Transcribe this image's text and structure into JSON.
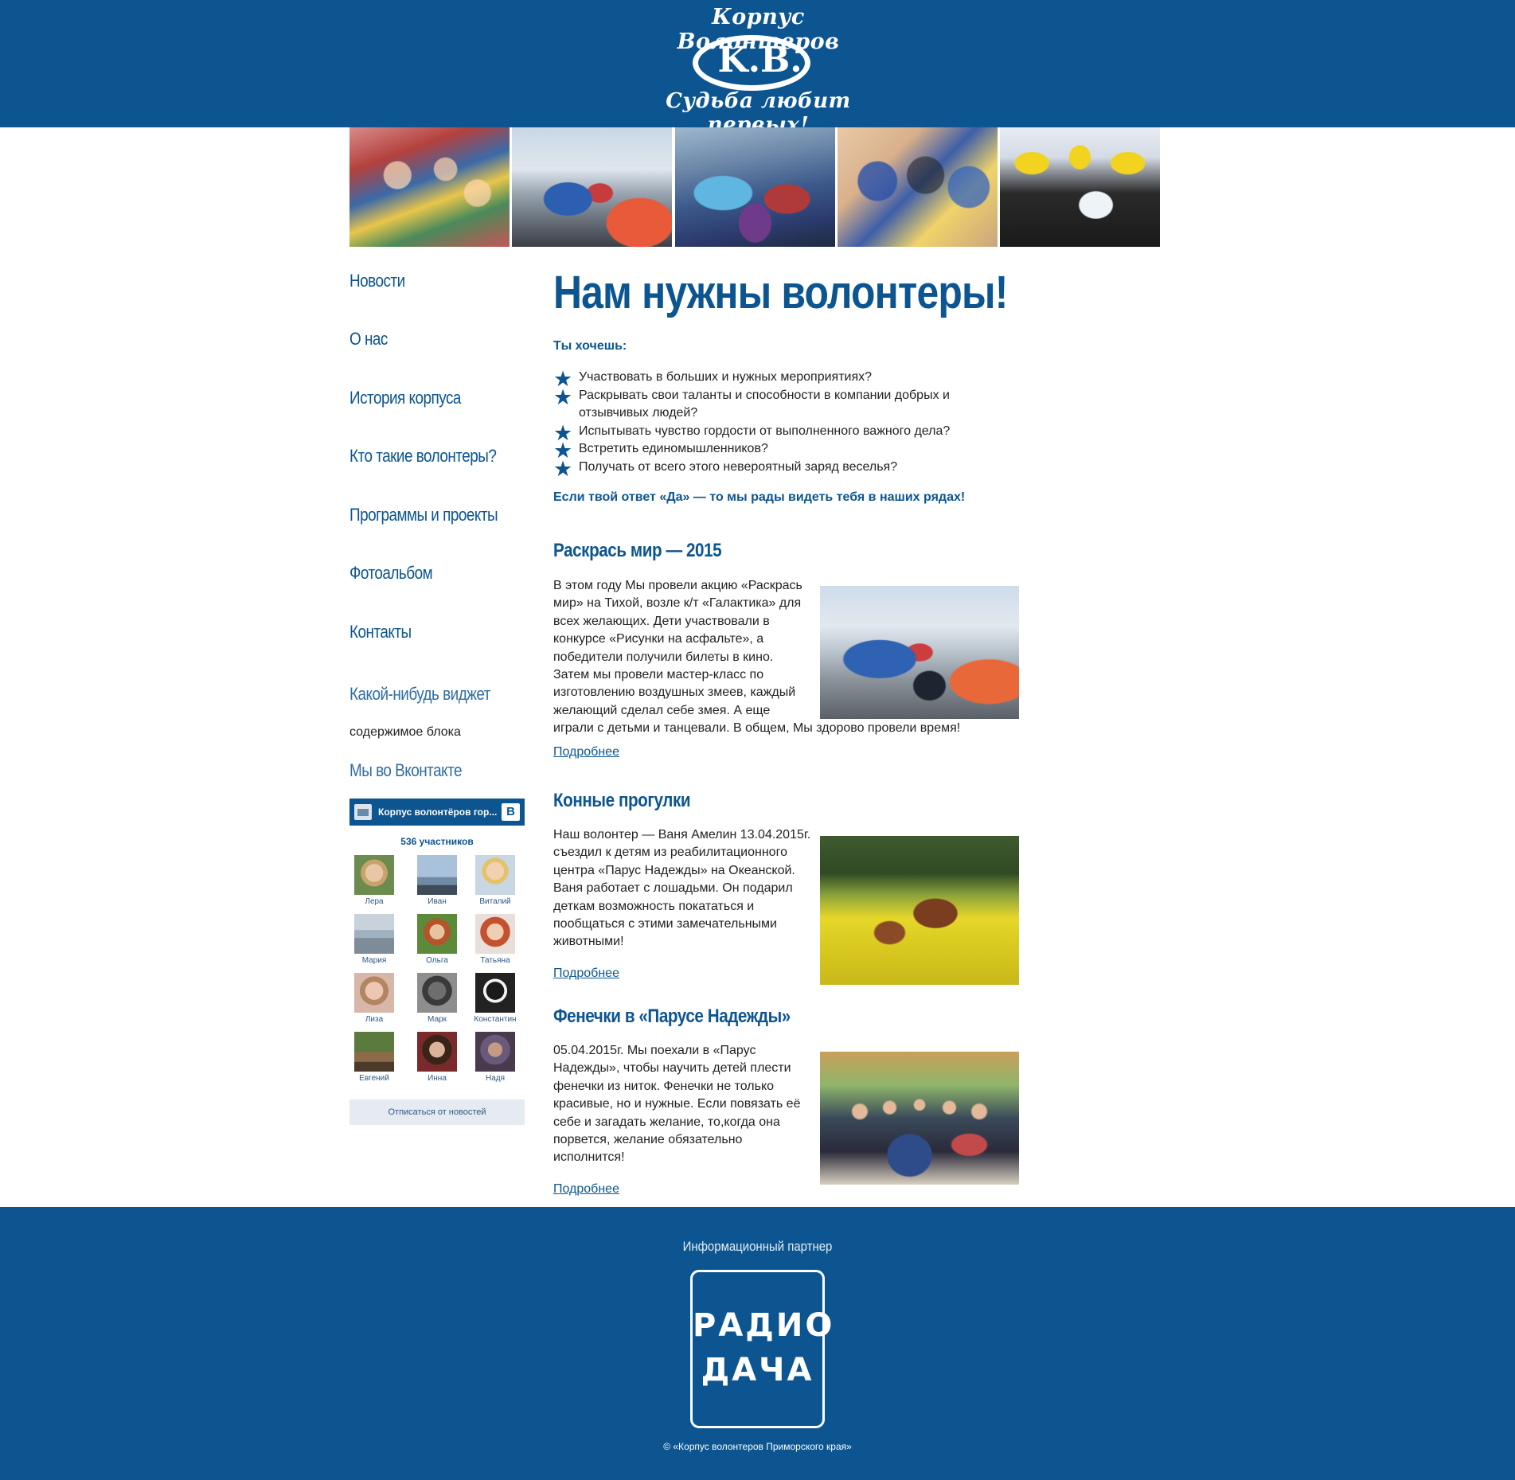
{
  "colors": {
    "brand": "#0c5590",
    "link": "#0c5590",
    "widget_title": "#2f6da3"
  },
  "header": {
    "logo_top": "Корпус Волонтеров",
    "logo_letters": "K.B.",
    "logo_slogan": "Судьба любит первых!"
  },
  "banner": {
    "photos": [
      {
        "name": "banner-photo-group-celebration"
      },
      {
        "name": "banner-photo-outdoor-event"
      },
      {
        "name": "banner-photo-costume-party"
      },
      {
        "name": "banner-photo-face-painting"
      },
      {
        "name": "banner-photo-yellow-caps"
      }
    ]
  },
  "sidebar": {
    "nav": [
      {
        "label": "Новости"
      },
      {
        "label": "О нас"
      },
      {
        "label": "История корпуса"
      },
      {
        "label": "Кто такие волонтеры?"
      },
      {
        "label": "Программы и проекты"
      },
      {
        "label": "Фотоальбом"
      },
      {
        "label": "Контакты"
      }
    ],
    "widget_title": "Какой-нибудь виджет",
    "widget_text": "содержимое блока",
    "vk_title": "Мы во Вконтакте",
    "vk": {
      "group_name": "Корпус волонтёров гор...",
      "logo_letter": "B",
      "members_count": "536 участников",
      "members": [
        "Лера",
        "Иван",
        "Виталий",
        "Мария",
        "Ольга",
        "Татьяна",
        "Лиза",
        "Марк",
        "Константин",
        "Евгений",
        "Инна",
        "Надя"
      ],
      "unsubscribe": "Отписаться от новостей"
    }
  },
  "main": {
    "title": "Нам нужны волонтеры!",
    "question": "Ты хочешь:",
    "bullets": [
      "Участвовать в больших и нужных мероприятиях?",
      "Раскрывать свои таланты и способности в компании добрых и отзывчивых людей?",
      "Испытывать чувство гордости от выполненного важного дела?",
      "Встретить единомышленников?",
      "Получать от всего этого невероятный заряд веселья?"
    ],
    "call": "Если твой ответ «Да» — то мы рады видеть тебя в наших рядах!",
    "posts": [
      {
        "title": "Раскрась мир — 2015",
        "text_lines": [
          "В этом году Мы провели акцию «Раскрась",
          "мир» на Тихой, возле к/т «Галактика» для",
          "всех желающих. Дети участвовали в",
          "конкурсе «Рисунки на асфальте», а",
          "победители получили билеты в кино.",
          "Затем мы провели мастер-класс по",
          "изготовлению воздушных змеев, каждый",
          "желающий сделал себе змея. А еще",
          "играли с детьми и танцевали. В общем, Мы здорово провели время!"
        ],
        "more": "Подробнее"
      },
      {
        "title": "Конные прогулки",
        "text_lines": [
          "Наш волонтер — Ваня Амелин 13.04.2015г.",
          "съездил к детям из реабилитационного",
          "центра «Парус Надежды» на Океанской.",
          "Ваня работает с лошадьми. Он подарил",
          "деткам возможность покататься и",
          "пообщаться с этими замечательными",
          "животными!"
        ],
        "more": "Подробнее"
      },
      {
        "title": "Фенечки в «Парусе Надежды»",
        "text_lines": [
          "05.04.2015г. Мы поехали в «Парус",
          "Надежды», чтобы научить детей плести",
          "фенечки из ниток. Фенечки не только",
          "красивые, но и нужные. Если повязать её",
          "себе и загадать желание, то,когда она",
          "порвется, желание обязательно",
          "исполнится!"
        ],
        "more": "Подробнее"
      }
    ]
  },
  "footer": {
    "partner_label": "Информационный партнер",
    "radio_line1": "РАДИО",
    "radio_line2": "ДАЧА",
    "copyright": "© «Корпус волонтеров Приморского края»"
  }
}
